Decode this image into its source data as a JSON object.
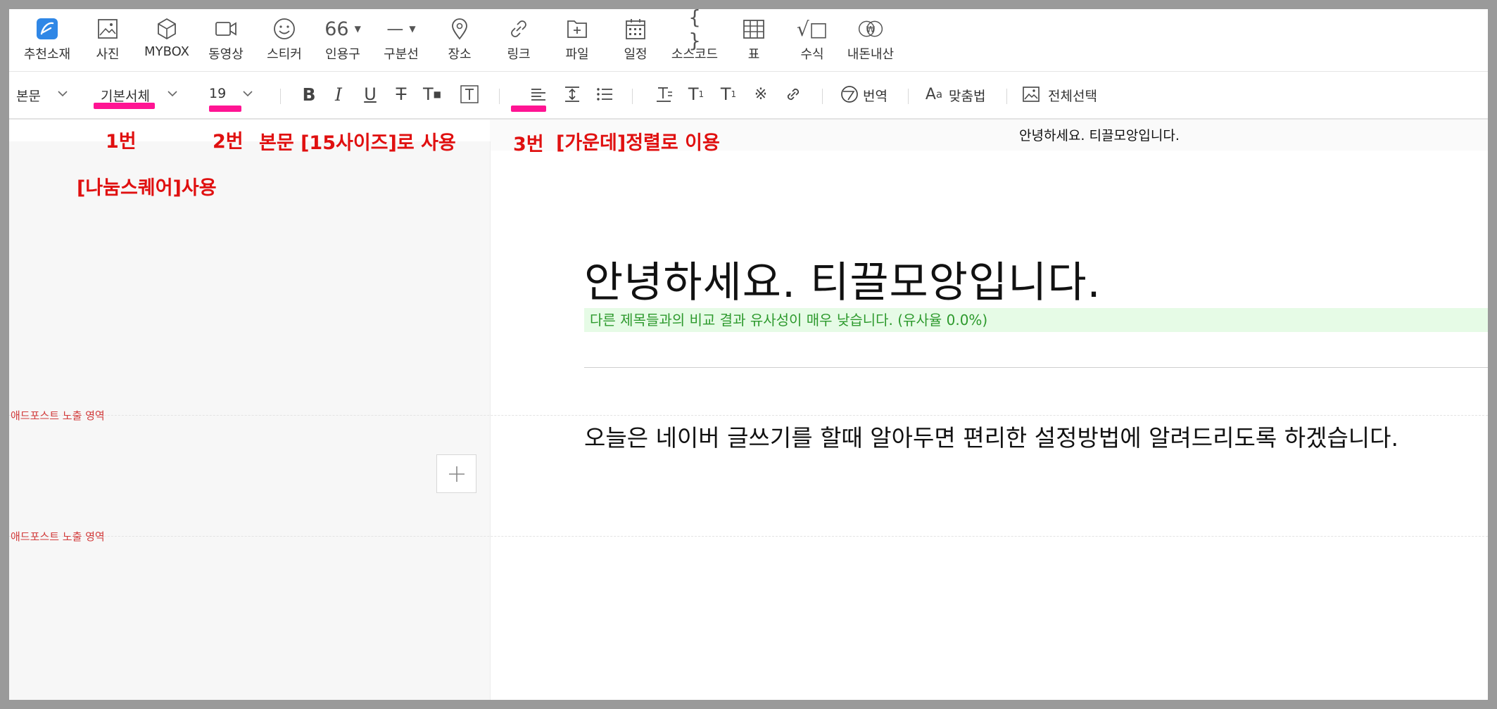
{
  "insert_toolbar": {
    "items": [
      {
        "label": "추천소재",
        "icon": "naver-recommend-icon"
      },
      {
        "label": "사진",
        "icon": "image-icon"
      },
      {
        "label": "MYBOX",
        "icon": "cube-icon"
      },
      {
        "label": "동영상",
        "icon": "video-icon"
      },
      {
        "label": "스티커",
        "icon": "smiley-icon"
      },
      {
        "label": "인용구",
        "icon": "quote-icon",
        "glyph": "66"
      },
      {
        "label": "구분선",
        "icon": "divider-icon",
        "glyph": "—"
      },
      {
        "label": "장소",
        "icon": "map-pin-icon"
      },
      {
        "label": "링크",
        "icon": "link-icon"
      },
      {
        "label": "파일",
        "icon": "file-add-icon"
      },
      {
        "label": "일정",
        "icon": "calendar-icon"
      },
      {
        "label": "소스코드",
        "icon": "code-braces-icon",
        "glyph": "{ }"
      },
      {
        "label": "표",
        "icon": "table-icon"
      },
      {
        "label": "수식",
        "icon": "formula-sqrt-icon",
        "glyph": "√□"
      },
      {
        "label": "내돈내산",
        "icon": "won-coin-icon",
        "glyph": "₩"
      }
    ]
  },
  "format_toolbar": {
    "paragraph_style": "본문",
    "font_family": "기본서체",
    "font_size": "19",
    "translate_label": "번역",
    "spellcheck_label": "맞춤법",
    "select_all_label": "전체선택"
  },
  "annotations": {
    "a1": "1번",
    "a1_detail": "[나눔스퀘어]사용",
    "a2": "2번",
    "a2_detail": "본문 [15사이즈]로 사용",
    "a3": "3번",
    "a3_detail": "[가운데]정렬로 이용"
  },
  "document": {
    "top_title": "안녕하세요. 티끌모앙입니다.",
    "title": "안녕하세요. 티끌모앙입니다.",
    "similarity_note": "다른 제목들과의 비교 결과 유사성이 매우 낮습니다. (유사율 0.0%)",
    "body": "오늘은 네이버 글쓰기를 할때 알아두면 편리한 설정방법에 알려드리도록 하겠습니다."
  },
  "ad_area_label": "애드포스트 노출 영역",
  "colors": {
    "annotation": "#e01010",
    "marker": "#ff1493",
    "similarity_bg": "#e6fbe6",
    "similarity_text": "#2d9a2d",
    "naver_blue": "#2f87e6"
  }
}
